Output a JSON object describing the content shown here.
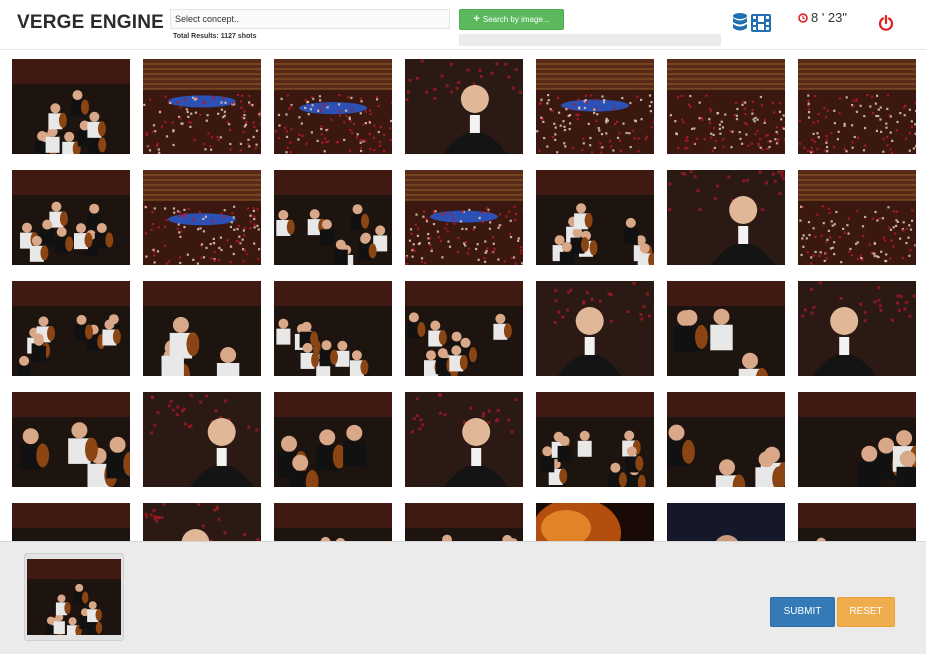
{
  "header": {
    "brand": "VERGE ENGINE",
    "concept_placeholder": "Select concept..",
    "total_results": "Total Results: 1127 shots",
    "search_image_label": "Search by image...",
    "upload_progress": 0,
    "view_icons": [
      "database-icon",
      "film-icon"
    ],
    "timer": "8 ' 23\"",
    "timer_icon": "clock-icon",
    "power_icon": "power-icon"
  },
  "results": {
    "columns": 7,
    "visible_rows": 5,
    "thumbnails": [
      {
        "scene": "orchestra"
      },
      {
        "scene": "hall-wide"
      },
      {
        "scene": "hall-wide"
      },
      {
        "scene": "portrait"
      },
      {
        "scene": "hall-wide"
      },
      {
        "scene": "audience"
      },
      {
        "scene": "audience"
      },
      {
        "scene": "orchestra"
      },
      {
        "scene": "hall-wide"
      },
      {
        "scene": "orchestra"
      },
      {
        "scene": "hall-wide"
      },
      {
        "scene": "orchestra"
      },
      {
        "scene": "portrait"
      },
      {
        "scene": "audience"
      },
      {
        "scene": "orchestra"
      },
      {
        "scene": "strings"
      },
      {
        "scene": "orchestra"
      },
      {
        "scene": "orchestra"
      },
      {
        "scene": "portrait"
      },
      {
        "scene": "strings"
      },
      {
        "scene": "portrait"
      },
      {
        "scene": "strings"
      },
      {
        "scene": "portrait"
      },
      {
        "scene": "strings"
      },
      {
        "scene": "portrait"
      },
      {
        "scene": "orchestra"
      },
      {
        "scene": "strings"
      },
      {
        "scene": "strings"
      },
      {
        "scene": "orchestra"
      },
      {
        "scene": "portrait"
      },
      {
        "scene": "orchestra"
      },
      {
        "scene": "orchestra"
      },
      {
        "scene": "fire"
      },
      {
        "scene": "dark"
      },
      {
        "scene": "orchestra"
      }
    ]
  },
  "selection": {
    "selected": [
      {
        "scene": "orchestra"
      }
    ]
  },
  "actions": {
    "submit_label": "SUBMIT",
    "reset_label": "RESET"
  },
  "colors": {
    "brand_text": "#2b2b2b",
    "search_button": "#5cb85c",
    "submit_button": "#337ab7",
    "reset_button": "#f0ad4e",
    "icon_blue": "#1f6fb2",
    "alert_red": "#e02020"
  }
}
